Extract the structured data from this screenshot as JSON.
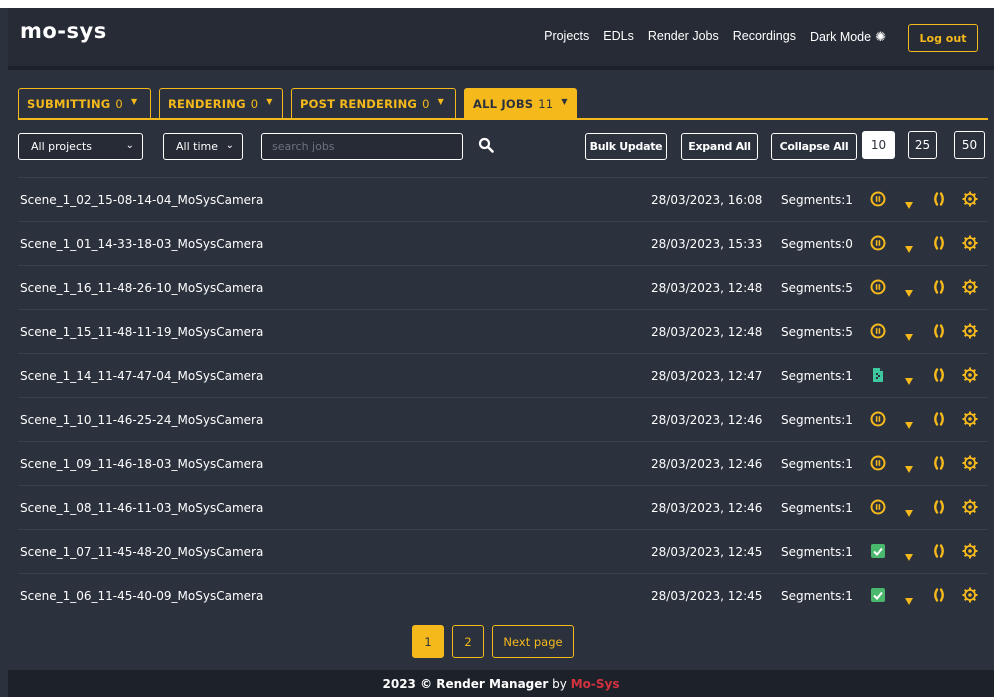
{
  "app": {
    "logo_text": "mo-sys",
    "nav": [
      "Projects",
      "EDLs",
      "Render Jobs",
      "Recordings"
    ],
    "dark_mode_label": "Dark Mode",
    "logout_label": "Log out"
  },
  "tabs": [
    {
      "label": "SUBMITTING",
      "count": "0",
      "active": false
    },
    {
      "label": "RENDERING",
      "count": "0",
      "active": false
    },
    {
      "label": "POST RENDERING",
      "count": "0",
      "active": false
    },
    {
      "label": "ALL JOBS",
      "count": "11",
      "active": true
    }
  ],
  "filters": {
    "project_select": "All projects",
    "time_select": "All time",
    "search_placeholder": "search jobs",
    "bulk_update_label": "Bulk Update",
    "expand_all_label": "Expand All",
    "collapse_all_label": "Collapse All",
    "page_sizes": [
      "10",
      "25",
      "50"
    ],
    "active_page_size": "10"
  },
  "jobs": [
    {
      "name": "Scene_1_02_15-08-14-04_MoSysCamera",
      "date": "28/03/2023, 16:08",
      "segments": "Segments:1",
      "status": "paused"
    },
    {
      "name": "Scene_1_01_14-33-18-03_MoSysCamera",
      "date": "28/03/2023, 15:33",
      "segments": "Segments:0",
      "status": "paused"
    },
    {
      "name": "Scene_1_16_11-48-26-10_MoSysCamera",
      "date": "28/03/2023, 12:48",
      "segments": "Segments:5",
      "status": "paused"
    },
    {
      "name": "Scene_1_15_11-48-11-19_MoSysCamera",
      "date": "28/03/2023, 12:48",
      "segments": "Segments:5",
      "status": "paused"
    },
    {
      "name": "Scene_1_14_11-47-47-04_MoSysCamera",
      "date": "28/03/2023, 12:47",
      "segments": "Segments:1",
      "status": "file"
    },
    {
      "name": "Scene_1_10_11-46-25-24_MoSysCamera",
      "date": "28/03/2023, 12:46",
      "segments": "Segments:1",
      "status": "paused"
    },
    {
      "name": "Scene_1_09_11-46-18-03_MoSysCamera",
      "date": "28/03/2023, 12:46",
      "segments": "Segments:1",
      "status": "paused"
    },
    {
      "name": "Scene_1_08_11-46-11-03_MoSysCamera",
      "date": "28/03/2023, 12:46",
      "segments": "Segments:1",
      "status": "paused"
    },
    {
      "name": "Scene_1_07_11-45-48-20_MoSysCamera",
      "date": "28/03/2023, 12:45",
      "segments": "Segments:1",
      "status": "completed"
    },
    {
      "name": "Scene_1_06_11-45-40-09_MoSysCamera",
      "date": "28/03/2023, 12:45",
      "segments": "Segments:1",
      "status": "completed"
    }
  ],
  "pagination": {
    "pages": [
      "1",
      "2"
    ],
    "active_page": "1",
    "next_label": "Next page"
  },
  "footer": {
    "copyright": "2023 © Render Manager",
    "by": "by",
    "brand": "Mo-Sys"
  },
  "colors": {
    "accent": "#f5b91c",
    "background": "#2b313d",
    "navbar": "#262b35",
    "status_file": "#3ec8a0",
    "status_completed": "#49b86d",
    "brand_red": "#d4323f"
  },
  "icons": {
    "status_paused": "pause-circle-icon",
    "status_file": "file-icon",
    "status_completed": "checkbox-icon",
    "row_caret": "caret-down-icon",
    "row_code": "code-brackets-icon",
    "row_settings": "settings-gear-icon",
    "search": "search-icon",
    "dark_mode": "sun-icon"
  }
}
